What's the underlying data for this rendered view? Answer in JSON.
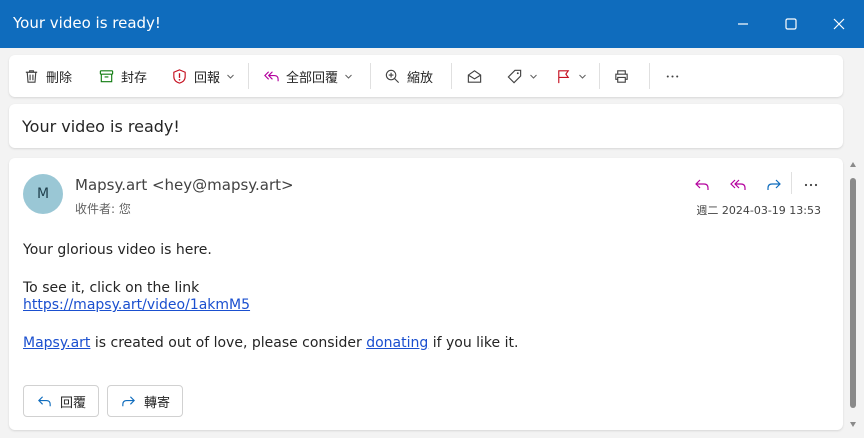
{
  "window": {
    "title": "Your video is ready!",
    "controls": [
      "minimize-icon",
      "maximize-icon",
      "close-icon"
    ]
  },
  "toolbar": {
    "delete_label": "刪除",
    "archive_label": "封存",
    "report_label": "回報",
    "reply_all_label": "全部回覆",
    "zoom_label": "縮放",
    "icons": [
      "trash-icon",
      "archive-icon",
      "shield-alert-icon",
      "reply-all-icon",
      "zoom-icon",
      "envelope-open-icon",
      "tag-icon",
      "flag-icon",
      "printer-icon",
      "more-icon"
    ]
  },
  "subject": "Your video is ready!",
  "message": {
    "avatar_initial": "M",
    "sender": "Mapsy.art <hey@mapsy.art>",
    "recipient_label": "收件者:",
    "recipient": "您",
    "date": "週二 2024-03-19 13:53",
    "body": {
      "line1": "Your glorious video is here.",
      "line2": "To see it, click on the link",
      "link": "https://mapsy.art/video/1akmM5",
      "line3_link1": "Mapsy.art",
      "line3_mid": " is created out of love, please consider ",
      "line3_link2": "donating",
      "line3_end": " if you like it."
    }
  },
  "actions": {
    "reply_label": "回覆",
    "forward_label": "轉寄"
  },
  "colors": {
    "titlebar": "#0f6cbd",
    "reply_purple": "#b4009e",
    "forward_blue": "#0f6cbd",
    "report_red": "#c50f1f",
    "archive_green": "#107c10",
    "link": "#1a4fcf"
  }
}
